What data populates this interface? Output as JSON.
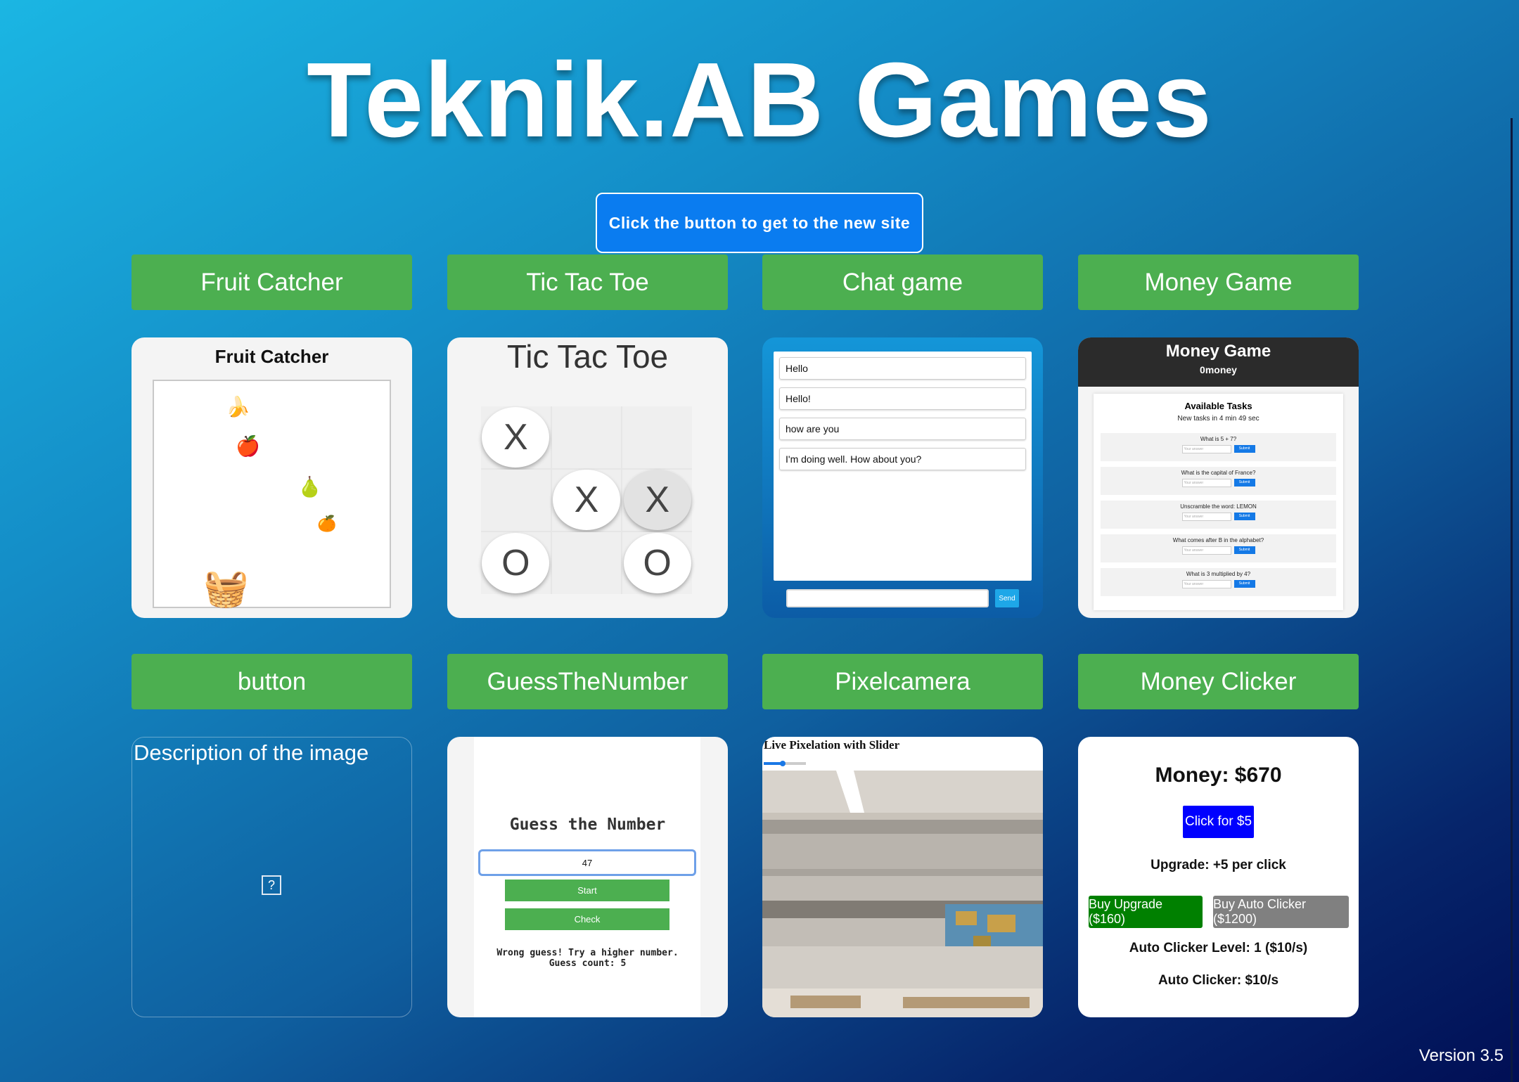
{
  "page": {
    "title": "Teknik.AB Games",
    "new_site_button": "Click the button to get to the new site",
    "version": "Version 3.5"
  },
  "games": [
    {
      "label": "Fruit Catcher"
    },
    {
      "label": "Tic Tac Toe"
    },
    {
      "label": "Chat game"
    },
    {
      "label": "Money Game"
    },
    {
      "label": "button"
    },
    {
      "label": "GuessTheNumber"
    },
    {
      "label": "Pixelcamera"
    },
    {
      "label": "Money Clicker"
    }
  ],
  "previews": {
    "fruit_catcher": {
      "title": "Fruit Catcher"
    },
    "tic_tac_toe": {
      "title": "Tic Tac Toe",
      "board": [
        "X",
        "",
        "",
        "",
        "X",
        "X",
        "O",
        "",
        "O"
      ]
    },
    "chat": {
      "messages": [
        "Hello",
        "Hello!",
        "how are you",
        "I'm doing well. How about you?"
      ],
      "send_label": "Send"
    },
    "money_game": {
      "title": "Money Game",
      "balance": "0money",
      "tasks_title": "Available Tasks",
      "timer": "New tasks in 4 min 49 sec",
      "input_placeholder": "Your answer",
      "submit_label": "Submit",
      "tasks": [
        "What is 5 + 7?",
        "What is the capital of France?",
        "Unscramble the word: LEMON",
        "What comes after B in the alphabet?",
        "What is 3 multiplied by 4?"
      ]
    },
    "broken_image": {
      "alt": "Description of the image",
      "icon": "?"
    },
    "guess_number": {
      "title": "Guess the Number",
      "input_value": "47",
      "start_label": "Start",
      "check_label": "Check",
      "result_line1": "Wrong guess! Try a higher number.",
      "result_line2": "Guess count: 5"
    },
    "pixelcamera": {
      "title": "Live Pixelation with Slider",
      "slider_level": 0.45
    },
    "money_clicker": {
      "money": "Money: $670",
      "click_label": "Click for $5",
      "upgrade_text": "Upgrade: +5 per click",
      "buy_upgrade": "Buy Upgrade ($160)",
      "buy_auto": "Buy Auto Clicker ($1200)",
      "auto_level": "Auto Clicker Level: 1 ($10/s)",
      "auto_rate": "Auto Clicker: $10/s"
    }
  },
  "colors": {
    "game_button": "#4caf50",
    "new_site_button": "#0a7cf0",
    "click_button": "#0000ff",
    "buy_upgrade": "#008000",
    "buy_auto": "#808080"
  }
}
